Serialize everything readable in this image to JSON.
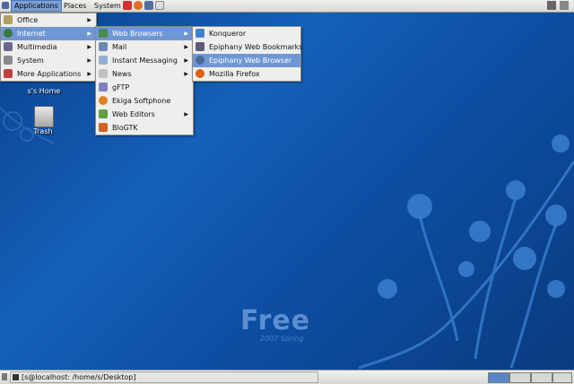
{
  "top_panel": {
    "menus": [
      "Applications",
      "Places",
      "System"
    ]
  },
  "app_menu": {
    "items": [
      {
        "label": "Office",
        "icon": "office-icon",
        "color": "#b0a060"
      },
      {
        "label": "Internet",
        "icon": "globe-icon",
        "color": "#3a7a3a"
      },
      {
        "label": "Multimedia",
        "icon": "multimedia-icon",
        "color": "#6a6a90"
      },
      {
        "label": "System",
        "icon": "system-icon",
        "color": "#8a8a8a"
      },
      {
        "label": "More Applications",
        "icon": "more-apps-icon",
        "color": "#c04040"
      }
    ]
  },
  "internet_menu": {
    "items": [
      {
        "label": "Web Browsers",
        "color": "#4a8a4a"
      },
      {
        "label": "Mail",
        "color": "#6a8ab0"
      },
      {
        "label": "Instant Messaging",
        "color": "#90b0d0"
      },
      {
        "label": "News",
        "color": "#c0c0c0"
      },
      {
        "label": "gFTP",
        "color": "#8080c0"
      },
      {
        "label": "Ekiga Softphone",
        "color": "#e08020"
      },
      {
        "label": "Web Editors",
        "color": "#60a040"
      },
      {
        "label": "BloGTK",
        "color": "#d06020"
      }
    ]
  },
  "browser_menu": {
    "items": [
      {
        "label": "Konqueror",
        "color": "#4080d0"
      },
      {
        "label": "Epiphany Web Bookmarks",
        "color": "#5a5a7a"
      },
      {
        "label": "Epiphany Web Browser",
        "color": "#4a6a9a"
      },
      {
        "label": "Mozilla Firefox",
        "color": "#e06010"
      }
    ]
  },
  "desktop": {
    "home_label": "s's Home",
    "trash_label": "Trash",
    "wallpaper_title": "Free",
    "wallpaper_subtitle": "2007 Spring"
  },
  "bottom_panel": {
    "task_label": "[s@localhost: /home/s/Desktop]"
  }
}
